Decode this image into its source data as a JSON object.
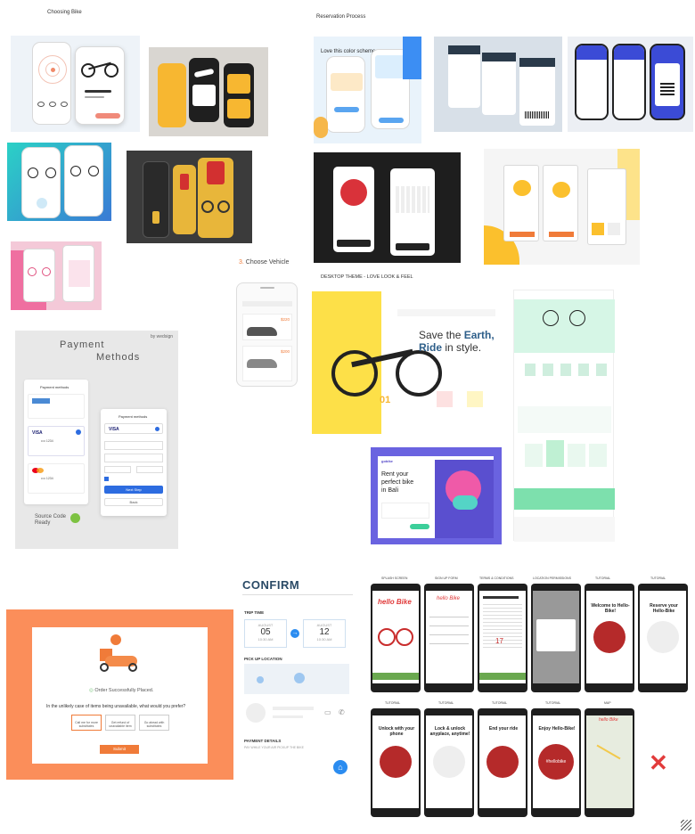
{
  "sections": {
    "choosing_bike": "Choosing Bike",
    "reservation_process": "Reservation Process",
    "choose_vehicle_num": "3.",
    "choose_vehicle": "Choose Vehicle",
    "desktop_theme": "DESKTOP THEME - LOVE LOOK & FEEL"
  },
  "love_color_scheme": "Love this color scheme",
  "payment": {
    "title_line1": "Payment",
    "title_line2": "Methods",
    "credit": "by wedsign",
    "card_header": "Payment methods",
    "visa": "VISA",
    "num1": "•••• 1234",
    "num2": "•••• 1234",
    "num3": "•••• 1234",
    "source_line1": "Source Code",
    "source_line2": "Ready",
    "add_button": "Next Step",
    "back_button": "Back"
  },
  "vehicle": {
    "price1": "$220",
    "price2": "$200",
    "price3": "$200"
  },
  "desktop": {
    "headline_line1": "Save the ",
    "headline_strong1": "Earth,",
    "headline_strong2": "Ride",
    "headline_line2": " in style.",
    "number": "01"
  },
  "rent": {
    "brand": "gobike",
    "line1": "Rent your",
    "line2": "perfect bike",
    "line3": "in Bali"
  },
  "order": {
    "success": "Order Successfully Placed.",
    "question": "In the unlikely case of items being unavailable, what would you prefer?",
    "opt1": "Call me for more substitutes",
    "opt2": "Get refund of unavailable item",
    "opt3": "Go ahead with substitutes",
    "submit": "Submit"
  },
  "confirm": {
    "title": "CONFIRM",
    "trip_time": "TRIP TIME",
    "from_label": "AUGUST",
    "from_day": "05",
    "from_time": "10:30 AM",
    "to_label": "AUGUST",
    "to_day": "12",
    "to_time": "10:30 AM",
    "pickup": "PICK UP LOCATION",
    "payment_details": "PAYMENT DETAILS",
    "pay_note": "PAY WHILE YOUR AIR PICKUP THE BIKE"
  },
  "hello_bike": {
    "top_labels": [
      "SPLASH SCREEN",
      "SIGN UP FORM",
      "TERMS & CONDITIONS",
      "LOCATION PERMISSIONS",
      "TUTORIAL",
      "TUTORIAL"
    ],
    "bottom_labels": [
      "TUTORIAL",
      "TUTORIAL",
      "TUTORIAL",
      "TUTORIAL",
      "MAP"
    ],
    "logo": "hello Bike",
    "welcome": "Welcome to Hello-Bike!",
    "reserve": "Reserve your Hello-Bike",
    "unlock": "Unlock with your phone",
    "lock": "Lock & unlock anyplace, anytime!",
    "ride": "End your ride",
    "enjoy": "Enjoy Hello-Bike!",
    "hashtag": "#hellobike",
    "timer": "17"
  }
}
